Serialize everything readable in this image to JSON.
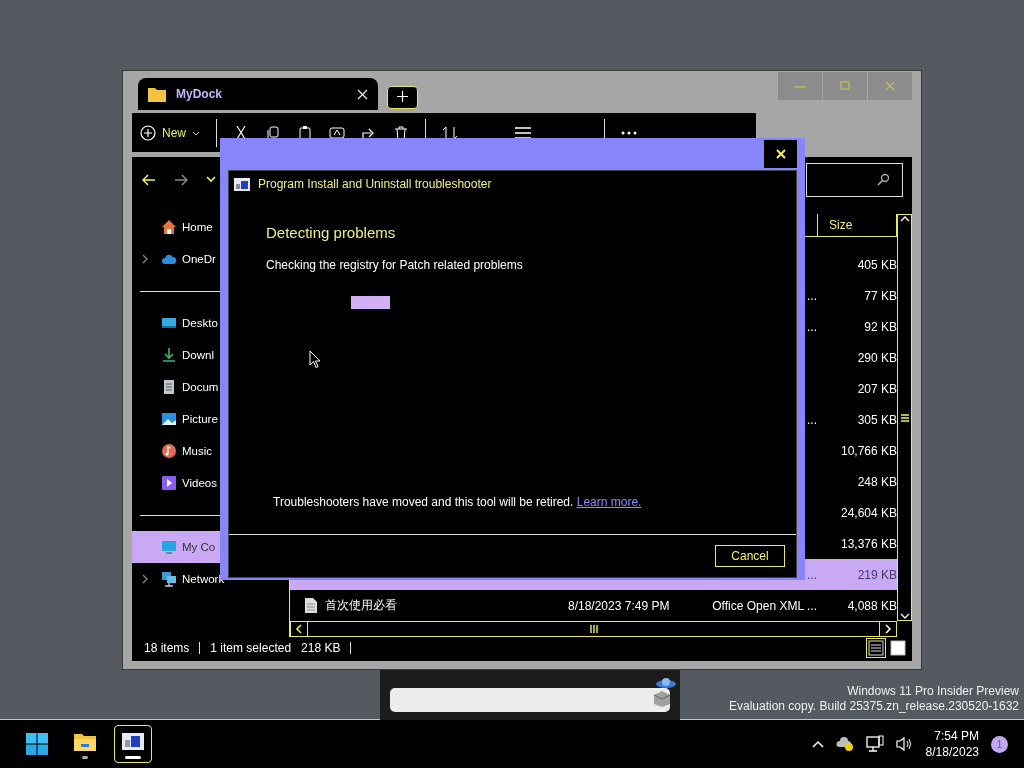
{
  "explorer": {
    "tab": {
      "title": "MyDock"
    },
    "toolbar": {
      "new_label": "New"
    },
    "sidebar": {
      "sections": [
        [
          {
            "kind": "home",
            "label": "Home",
            "expandable": false,
            "selected": false
          },
          {
            "kind": "cloud",
            "label": "OneDr",
            "expandable": true,
            "selected": false
          }
        ],
        [
          {
            "kind": "desktop",
            "label": "Deskto",
            "expandable": false,
            "selected": false
          },
          {
            "kind": "download",
            "label": "Downl",
            "expandable": false,
            "selected": false
          },
          {
            "kind": "document",
            "label": "Docum",
            "expandable": false,
            "selected": false
          },
          {
            "kind": "picture",
            "label": "Picture",
            "expandable": false,
            "selected": false
          },
          {
            "kind": "music",
            "label": "Music",
            "expandable": false,
            "selected": false
          },
          {
            "kind": "video",
            "label": "Videos",
            "expandable": false,
            "selected": false
          }
        ],
        [
          {
            "kind": "computer",
            "label": "My Co",
            "expandable": false,
            "selected": true
          },
          {
            "kind": "network",
            "label": "Network",
            "expandable": true,
            "selected": false
          }
        ]
      ]
    },
    "table": {
      "columns": [
        {
          "label": "Size"
        }
      ],
      "rows": [
        {
          "size": "405 KB",
          "selected": false
        },
        {
          "type": "...",
          "size": "77 KB",
          "selected": false
        },
        {
          "type": "...",
          "size": "92 KB",
          "selected": false
        },
        {
          "size": "290 KB",
          "selected": false
        },
        {
          "size": "207 KB",
          "selected": false
        },
        {
          "type": "...",
          "size": "305 KB",
          "selected": false
        },
        {
          "size": "10,766 KB",
          "selected": false
        },
        {
          "size": "248 KB",
          "selected": false
        },
        {
          "size": "24,604 KB",
          "selected": false
        },
        {
          "size": "13,376 KB",
          "selected": false
        },
        {
          "type": "...",
          "size": "219 KB",
          "selected": true
        },
        {
          "name": "首次使用必看",
          "modified": "8/18/2023 7:49 PM",
          "type": "Office Open XML ...",
          "size": "4,088 KB",
          "selected": false
        }
      ]
    },
    "status_bar": {
      "items": "18 items",
      "selection": "1 item selected",
      "selection_size": "218 KB"
    }
  },
  "dialog": {
    "title": "Program Install and Uninstall troubleshooter",
    "heading": "Detecting problems",
    "status": "Checking the registry for Patch related problems",
    "notice": "Troubleshooters have moved and this tool will be retired.",
    "link": "Learn more.",
    "cancel": "Cancel"
  },
  "watermark": [
    "Windows 11 Pro Insider Preview",
    "Evaluation copy. Build 25375.zn_release.230520-1632"
  ],
  "taskbar": {
    "apps": [
      {
        "kind": "start",
        "selected": false
      },
      {
        "kind": "explorer",
        "selected": false
      },
      {
        "kind": "troubleshooter",
        "selected": true
      }
    ],
    "time": "7:54 PM",
    "date": "8/18/2023",
    "notifications": "1"
  }
}
